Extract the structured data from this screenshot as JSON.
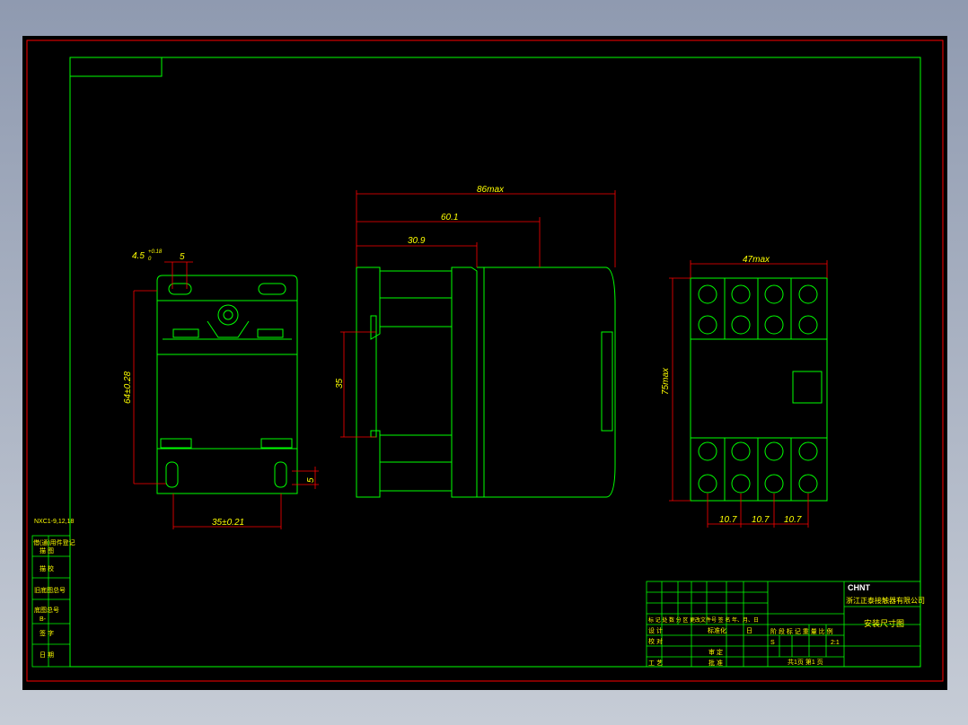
{
  "drawing": {
    "dims": {
      "d_4_5": "4.5",
      "d_4_5_tol_plus": "+0.18",
      "d_4_5_tol_zero": "0",
      "d_5_top": "5",
      "d_64": "64±0.28",
      "d_35": "35±0.21",
      "d_5_side": "5",
      "d_86": "86max",
      "d_60_1": "60.1",
      "d_30_9": "30.9",
      "d_35_rail": "35",
      "d_47": "47max",
      "d_75": "75max",
      "d_10_7_a": "10.7",
      "d_10_7_b": "10.7",
      "d_10_7_c": "10.7"
    },
    "left_panel": {
      "model": "NXC1-9,12,18",
      "r1": "借(通)用件登记",
      "r1b": "描 图",
      "r2": "描 校",
      "r3": "旧底图总号",
      "r4": "底图总号",
      "r4b": "B-",
      "r5": "签 字",
      "r6": "日 期"
    },
    "title_block": {
      "logo": "CHNT",
      "company": "浙江正泰接触器有限公司",
      "title": "安装尺寸图",
      "rev_header": "标 记 处 数  分 区  更改文件号 签 名 年、月、日",
      "design": "设 计",
      "standardize": "标准化",
      "check": "校 对",
      "process": "工 艺",
      "audit": "审 定",
      "approve": "批 准",
      "date_short": "日",
      "stage_header": "阶 段 标 记  重 量  比 例",
      "stage_s": "S",
      "scale": "2:1",
      "sheet": "共1页   第1 页"
    }
  }
}
